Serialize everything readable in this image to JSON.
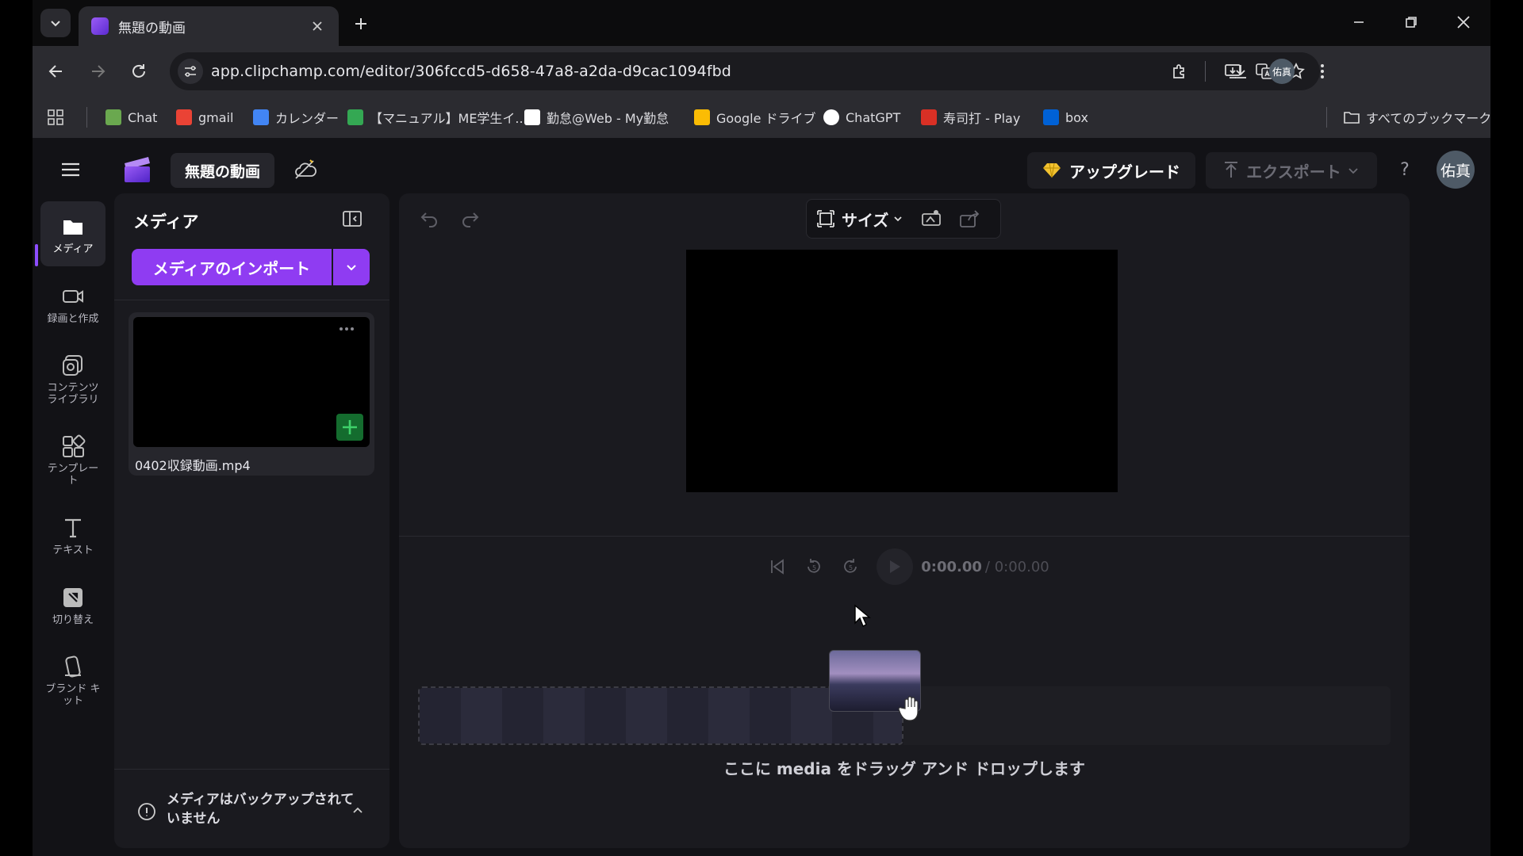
{
  "browser": {
    "tab": {
      "title": "無題の動画"
    },
    "url": "app.clipchamp.com/editor/306fccd5-d658-47a8-a2da-d9cac1094fbd",
    "profile_initials": "佑真",
    "bookmarks": [
      {
        "label": "Chat",
        "icon": "chat-icon",
        "color": "#6aa84f"
      },
      {
        "label": "gmail",
        "icon": "gmail-icon",
        "color": "#ea4335"
      },
      {
        "label": "カレンダー",
        "icon": "calendar-icon",
        "color": "#4285f4"
      },
      {
        "label": "【マニュアル】ME学生イ...",
        "icon": "plus-icon",
        "color": "#34a853"
      },
      {
        "label": "勤怠@Web - My勤怠",
        "icon": "clock-icon",
        "color": "#ffffff"
      },
      {
        "label": "Google ドライブ",
        "icon": "drive-icon",
        "color": "#fbbc04"
      },
      {
        "label": "ChatGPT",
        "icon": "openai-icon",
        "color": "#ffffff"
      },
      {
        "label": "寿司打 - Play",
        "icon": "sushida-icon",
        "color": "#d93025"
      },
      {
        "label": "box",
        "icon": "box-icon",
        "color": "#0061d5"
      }
    ],
    "all_bookmarks": "すべてのブックマーク"
  },
  "app": {
    "project_title": "無題の動画",
    "upgrade_label": "アップグレード",
    "export_label": "エクスポート",
    "help_label": "?",
    "user_initials": "佑真",
    "accent_color": "#8f3cf2",
    "rail": [
      {
        "label": "メディア",
        "icon": "folder-icon",
        "active": true
      },
      {
        "label": "録画と作成",
        "icon": "video-camera-icon",
        "active": false
      },
      {
        "label": "コンテンツ ライブラリ",
        "icon": "content-library-icon",
        "active": false
      },
      {
        "label": "テンプレー ト",
        "icon": "templates-icon",
        "active": false
      },
      {
        "label": "テキスト",
        "icon": "text-icon",
        "active": false
      },
      {
        "label": "切り替え",
        "icon": "transition-icon",
        "active": false
      },
      {
        "label": "ブランド キット",
        "icon": "brand-kit-icon",
        "active": false
      }
    ],
    "media_panel": {
      "title": "メディア",
      "import_label": "メディアのインポート",
      "items": [
        {
          "filename": "0402収録動画.mp4"
        }
      ],
      "backup_notice": "メディアはバックアップされていません"
    },
    "editor": {
      "size_label": "サイズ",
      "time_current": "0:00.00",
      "time_total": "/ 0:00.00",
      "drop_hint": "ここに media をドラッグ アンド ドロップします"
    }
  }
}
